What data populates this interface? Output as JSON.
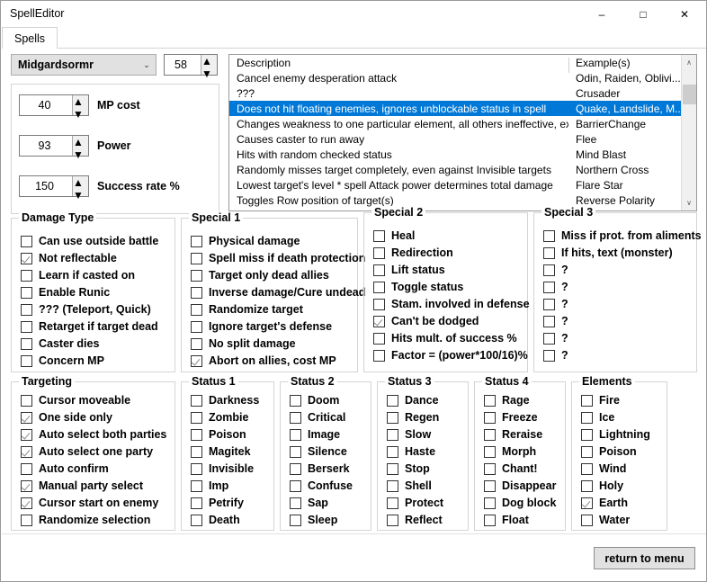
{
  "window": {
    "title": "SpellEditor",
    "minimize_glyph": "–",
    "maximize_glyph": "□",
    "close_glyph": "✕"
  },
  "tabs": [
    {
      "label": "Spells",
      "active": true
    }
  ],
  "selector": {
    "spell_name": "Midgardsormr",
    "dropdown_arrow": "⌄",
    "spell_index": "58",
    "spin_up": "▲",
    "spin_down": "▼"
  },
  "stats": [
    {
      "value": "40",
      "label": "MP cost"
    },
    {
      "value": "93",
      "label": "Power"
    },
    {
      "value": "150",
      "label": "Success rate %"
    }
  ],
  "description_list": {
    "columns": [
      "Description",
      "Example(s)"
    ],
    "scroll_up_glyph": "∧",
    "scroll_down_glyph": "∨",
    "rows": [
      {
        "description": "Cancel enemy desperation attack",
        "example": "Odin, Raiden, Oblivi...",
        "selected": false
      },
      {
        "description": "???",
        "example": "Crusader",
        "selected": false
      },
      {
        "description": "Does not hit floating enemies, ignores unblockable status in spell",
        "example": "Quake, Landslide, M...",
        "selected": true
      },
      {
        "description": "Changes weakness to one particular element, all others ineffective, exact op...",
        "example": "BarrierChange",
        "selected": false
      },
      {
        "description": "Causes caster to run away",
        "example": "Flee",
        "selected": false
      },
      {
        "description": "Hits with random checked status",
        "example": "Mind Blast",
        "selected": false
      },
      {
        "description": "Randomly misses target completely, even against Invisible targets",
        "example": "Northern Cross",
        "selected": false
      },
      {
        "description": "Lowest target's level * spell Attack power determines total damage",
        "example": "Flare Star",
        "selected": false
      },
      {
        "description": "Toggles Row position of target(s)",
        "example": "Reverse Polarity",
        "selected": false
      }
    ]
  },
  "groups": [
    {
      "title": "Damage Type",
      "items": [
        {
          "label": "Can use outside battle",
          "checked": false
        },
        {
          "label": "Not reflectable",
          "checked": true
        },
        {
          "label": "Learn if casted on",
          "checked": false
        },
        {
          "label": "Enable Runic",
          "checked": false
        },
        {
          "label": "??? (Teleport, Quick)",
          "checked": false
        },
        {
          "label": "Retarget if target dead",
          "checked": false
        },
        {
          "label": "Caster dies",
          "checked": false
        },
        {
          "label": "Concern MP",
          "checked": false
        }
      ]
    },
    {
      "title": "Special 1",
      "items": [
        {
          "label": "Physical damage",
          "checked": false
        },
        {
          "label": "Spell miss if death protection",
          "checked": false
        },
        {
          "label": "Target only dead allies",
          "checked": false
        },
        {
          "label": "Inverse damage/Cure undead",
          "checked": false
        },
        {
          "label": "Randomize target",
          "checked": false
        },
        {
          "label": "Ignore target's defense",
          "checked": false
        },
        {
          "label": "No split damage",
          "checked": false
        },
        {
          "label": "Abort on allies, cost MP",
          "checked": true
        }
      ]
    },
    {
      "title": "Special 2",
      "items": [
        {
          "label": "Heal",
          "checked": false
        },
        {
          "label": "Redirection",
          "checked": false
        },
        {
          "label": "Lift status",
          "checked": false
        },
        {
          "label": "Toggle status",
          "checked": false
        },
        {
          "label": "Stam. involved in defense",
          "checked": false
        },
        {
          "label": "Can't be dodged",
          "checked": true
        },
        {
          "label": "Hits mult. of success %",
          "checked": false
        },
        {
          "label": "Factor = (power*100/16)%",
          "checked": false
        }
      ]
    },
    {
      "title": "Special 3",
      "items": [
        {
          "label": "Miss if prot. from aliments",
          "checked": false
        },
        {
          "label": "If hits, text (monster)",
          "checked": false
        },
        {
          "label": "?",
          "checked": false
        },
        {
          "label": "?",
          "checked": false
        },
        {
          "label": "?",
          "checked": false
        },
        {
          "label": "?",
          "checked": false
        },
        {
          "label": "?",
          "checked": false
        },
        {
          "label": "?",
          "checked": false
        }
      ]
    },
    {
      "title": "Targeting",
      "items": [
        {
          "label": "Cursor moveable",
          "checked": false
        },
        {
          "label": "One side only",
          "checked": true
        },
        {
          "label": "Auto select both parties",
          "checked": true
        },
        {
          "label": "Auto select one party",
          "checked": true
        },
        {
          "label": "Auto confirm",
          "checked": false
        },
        {
          "label": "Manual party select",
          "checked": true
        },
        {
          "label": "Cursor start on enemy",
          "checked": true
        },
        {
          "label": "Randomize selection",
          "checked": false
        }
      ]
    },
    {
      "title": "Status 1",
      "items": [
        {
          "label": "Darkness",
          "checked": false
        },
        {
          "label": "Zombie",
          "checked": false
        },
        {
          "label": "Poison",
          "checked": false
        },
        {
          "label": "Magitek",
          "checked": false
        },
        {
          "label": "Invisible",
          "checked": false
        },
        {
          "label": "Imp",
          "checked": false
        },
        {
          "label": "Petrify",
          "checked": false
        },
        {
          "label": "Death",
          "checked": false
        }
      ]
    },
    {
      "title": "Status 2",
      "items": [
        {
          "label": "Doom",
          "checked": false
        },
        {
          "label": "Critical",
          "checked": false
        },
        {
          "label": "Image",
          "checked": false
        },
        {
          "label": "Silence",
          "checked": false
        },
        {
          "label": "Berserk",
          "checked": false
        },
        {
          "label": "Confuse",
          "checked": false
        },
        {
          "label": "Sap",
          "checked": false
        },
        {
          "label": "Sleep",
          "checked": false
        }
      ]
    },
    {
      "title": "Status 3",
      "items": [
        {
          "label": "Dance",
          "checked": false
        },
        {
          "label": "Regen",
          "checked": false
        },
        {
          "label": "Slow",
          "checked": false
        },
        {
          "label": "Haste",
          "checked": false
        },
        {
          "label": "Stop",
          "checked": false
        },
        {
          "label": "Shell",
          "checked": false
        },
        {
          "label": "Protect",
          "checked": false
        },
        {
          "label": "Reflect",
          "checked": false
        }
      ]
    },
    {
      "title": "Status 4",
      "items": [
        {
          "label": "Rage",
          "checked": false
        },
        {
          "label": "Freeze",
          "checked": false
        },
        {
          "label": "Reraise",
          "checked": false
        },
        {
          "label": "Morph",
          "checked": false
        },
        {
          "label": "Chant!",
          "checked": false
        },
        {
          "label": "Disappear",
          "checked": false
        },
        {
          "label": "Dog block",
          "checked": false
        },
        {
          "label": "Float",
          "checked": false
        }
      ]
    },
    {
      "title": "Elements",
      "items": [
        {
          "label": "Fire",
          "checked": false
        },
        {
          "label": "Ice",
          "checked": false
        },
        {
          "label": "Lightning",
          "checked": false
        },
        {
          "label": "Poison",
          "checked": false
        },
        {
          "label": "Wind",
          "checked": false
        },
        {
          "label": "Holy",
          "checked": false
        },
        {
          "label": "Earth",
          "checked": true
        },
        {
          "label": "Water",
          "checked": false
        }
      ]
    }
  ],
  "footer": {
    "return_label": "return to menu"
  },
  "colors": {
    "selection": "#0078d7",
    "button_face": "#e1e1e1",
    "group_border": "#d4d4d4"
  }
}
